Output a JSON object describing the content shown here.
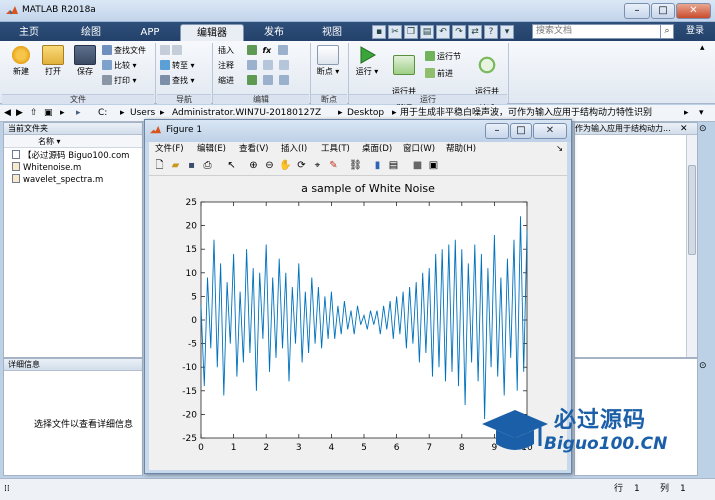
{
  "window": {
    "title": "MATLAB R2018a"
  },
  "ribbon_tabs": [
    {
      "label": "主页",
      "active": false
    },
    {
      "label": "绘图",
      "active": false
    },
    {
      "label": "APP",
      "active": false
    },
    {
      "label": "编辑器",
      "active": true
    },
    {
      "label": "发布",
      "active": false
    },
    {
      "label": "视图",
      "active": false
    }
  ],
  "search": {
    "placeholder": "搜索文档"
  },
  "login_label": "登录",
  "ribbon": {
    "file_group": {
      "label": "文件",
      "new_label": "新建",
      "open_label": "打开",
      "save_label": "保存",
      "find_files": "查找文件",
      "compare": "比较",
      "print": "打印"
    },
    "nav_group": {
      "label": "导航",
      "goto": "转至",
      "find": "查找"
    },
    "edit_group": {
      "label": "编辑",
      "insert": "插入",
      "comment": "注释",
      "indent": "缩进",
      "fx_symbol": "fx"
    },
    "breakpoint_group": {
      "label": "断点",
      "breakpoints": "断点"
    },
    "run_group": {
      "label": "运行",
      "run": "运行",
      "run_and_advance": "运行并\n前进",
      "run_section": "运行节",
      "advance": "前进",
      "run_and_time": "运行并\n计时"
    }
  },
  "address": {
    "segments": [
      "C:",
      "Users",
      "Administrator.WIN7U-20180127Z",
      "Desktop",
      "用于生成非平稳白噪声波，可作为输入应用于结构动力特性识别"
    ]
  },
  "folder_panel": {
    "title": "当前文件夹",
    "column_header": "名称",
    "files": [
      {
        "name": "【必过源码 Biguo100.com",
        "icon": "text-file-icon"
      },
      {
        "name": "Whitenoise.m",
        "icon": "m-file-icon"
      },
      {
        "name": "wavelet_spectra.m",
        "icon": "m-file-icon"
      }
    ]
  },
  "details_panel": {
    "title": "详细信息",
    "message": "选择文件以查看详细信息"
  },
  "right_panel": {
    "tab_label": "作为输入应用于结构动力..."
  },
  "status": {
    "row_label": "行",
    "row_value": "1",
    "col_label": "列",
    "col_value": "1"
  },
  "figure": {
    "title": "Figure 1",
    "menu": [
      "文件(F)",
      "编辑(E)",
      "查看(V)",
      "插入(I)",
      "工具(T)",
      "桌面(D)",
      "窗口(W)",
      "帮助(H)"
    ],
    "toolbar_icons": [
      "new-figure-icon",
      "open-icon",
      "save-icon",
      "print-icon",
      "pointer-icon",
      "zoom-in-icon",
      "zoom-out-icon",
      "pan-icon",
      "rotate-icon",
      "datatip-icon",
      "brush-icon",
      "link-icon",
      "colorbar-icon",
      "legend-icon",
      "hide-plot-tools-icon",
      "show-plot-tools-icon"
    ]
  },
  "watermark": {
    "brand": "必过源码",
    "url": "Biguo100.CN"
  },
  "colors": {
    "line": "#0072bd",
    "ribbon_dark": "#23416a",
    "window_bg": "#bcd0e6"
  },
  "chart_data": {
    "type": "line",
    "title": "a sample of White Noise",
    "xlabel": "",
    "ylabel": "",
    "xlim": [
      0,
      10
    ],
    "ylim": [
      -25,
      25
    ],
    "xticks": [
      0,
      1,
      2,
      3,
      4,
      5,
      6,
      7,
      8,
      9,
      10
    ],
    "yticks": [
      25,
      20,
      15,
      10,
      5,
      0,
      -5,
      -10,
      -15,
      -20,
      -25
    ],
    "grid": false,
    "series": [
      {
        "color": "#0072bd",
        "x": [
          0.0,
          0.1,
          0.2,
          0.3,
          0.4,
          0.5,
          0.6,
          0.7,
          0.8,
          0.9,
          1.0,
          1.1,
          1.2,
          1.3,
          1.4,
          1.5,
          1.6,
          1.7,
          1.8,
          1.9,
          2.0,
          2.1,
          2.2,
          2.3,
          2.4,
          2.5,
          2.6,
          2.7,
          2.8,
          2.9,
          3.0,
          3.1,
          3.2,
          3.3,
          3.4,
          3.5,
          3.6,
          3.7,
          3.8,
          3.9,
          4.0,
          4.1,
          4.2,
          4.3,
          4.4,
          4.5,
          4.6,
          4.7,
          4.8,
          4.9,
          5.0,
          5.1,
          5.2,
          5.3,
          5.4,
          5.5,
          5.6,
          5.7,
          5.8,
          5.9,
          6.0,
          6.1,
          6.2,
          6.3,
          6.4,
          6.5,
          6.6,
          6.7,
          6.8,
          6.9,
          7.0,
          7.1,
          7.2,
          7.3,
          7.4,
          7.5,
          7.6,
          7.7,
          7.8,
          7.9,
          8.0,
          8.1,
          8.2,
          8.3,
          8.4,
          8.5,
          8.6,
          8.7,
          8.8,
          8.9,
          9.0,
          9.1,
          9.2,
          9.3,
          9.4,
          9.5,
          9.6,
          9.7,
          9.8,
          9.9,
          10.0
        ],
        "y": [
          3,
          -14,
          9,
          -6,
          17,
          -10,
          12,
          -16,
          8,
          -5,
          14,
          -12,
          6,
          -9,
          15,
          -7,
          11,
          -15,
          10,
          -4,
          16,
          -11,
          9,
          -8,
          13,
          -6,
          10,
          -13,
          7,
          -5,
          12,
          -9,
          6,
          -7,
          9,
          -5,
          7,
          -6,
          5,
          -4,
          6,
          -4,
          3,
          -3,
          4,
          -2,
          2,
          -3,
          3,
          -1,
          1,
          -2,
          2,
          -1,
          2,
          -3,
          3,
          -2,
          4,
          -4,
          5,
          -3,
          6,
          -6,
          7,
          -5,
          8,
          -9,
          10,
          -7,
          11,
          -12,
          14,
          -10,
          15,
          -13,
          16,
          -11,
          17,
          -14,
          15,
          -18,
          12,
          -9,
          16,
          -13,
          14,
          -21,
          11,
          -10,
          18,
          -12,
          9,
          -16,
          13,
          -8,
          17,
          -15,
          22,
          -11,
          19
        ]
      }
    ]
  }
}
